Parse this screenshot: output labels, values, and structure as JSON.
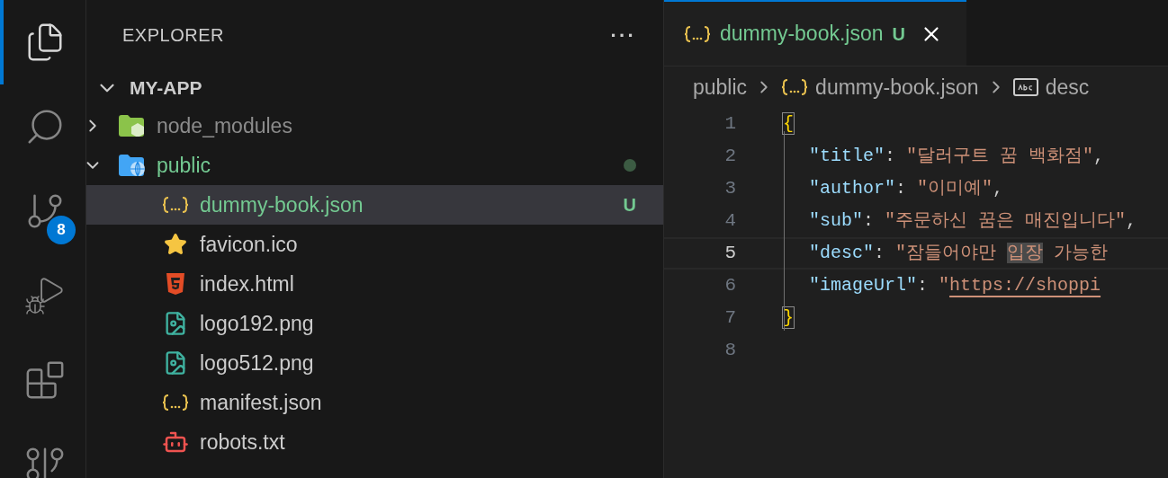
{
  "activity_bar": {
    "items": [
      {
        "kind": "files",
        "selected": true
      },
      {
        "kind": "search",
        "selected": false
      },
      {
        "kind": "source-control",
        "selected": false,
        "badge": "8"
      },
      {
        "kind": "run",
        "selected": false
      },
      {
        "kind": "extensions",
        "selected": false
      },
      {
        "kind": "graph",
        "selected": false
      }
    ]
  },
  "sidebar": {
    "title": "EXPLORER",
    "more": "···",
    "root": {
      "label": "MY-APP",
      "expanded": true,
      "children": [
        {
          "label": "node_modules",
          "kind": "folder-node",
          "expanded": false,
          "untracked": false,
          "ignored": true,
          "selected": false,
          "dot": false
        },
        {
          "label": "public",
          "kind": "folder-web",
          "expanded": true,
          "untracked": true,
          "ignored": false,
          "selected": false,
          "dot": true,
          "children": [
            {
              "label": "dummy-book.json",
              "kind": "json",
              "untracked": true,
              "ignored": false,
              "badge": "U",
              "selected": true
            },
            {
              "label": "favicon.ico",
              "kind": "star",
              "untracked": false,
              "ignored": false,
              "selected": false
            },
            {
              "label": "index.html",
              "kind": "html",
              "untracked": false,
              "ignored": false,
              "selected": false
            },
            {
              "label": "logo192.png",
              "kind": "image",
              "untracked": false,
              "ignored": false,
              "selected": false
            },
            {
              "label": "logo512.png",
              "kind": "image",
              "untracked": false,
              "ignored": false,
              "selected": false
            },
            {
              "label": "manifest.json",
              "kind": "json",
              "untracked": false,
              "ignored": false,
              "selected": false
            },
            {
              "label": "robots.txt",
              "kind": "robot",
              "untracked": false,
              "ignored": false,
              "selected": false
            }
          ]
        }
      ]
    }
  },
  "editor": {
    "tabs": [
      {
        "label": "dummy-book.json",
        "kind": "json",
        "badge": "U",
        "selected": true
      }
    ],
    "breadcrumbs": [
      {
        "label": "public",
        "kind": "folder"
      },
      {
        "label": "dummy-book.json",
        "kind": "json"
      },
      {
        "label": "desc",
        "kind": "string"
      }
    ],
    "lines": [
      {
        "number": "1",
        "selected": false,
        "tokens": [
          {
            "kind": "bracket-match",
            "text": "{"
          }
        ]
      },
      {
        "number": "2",
        "selected": false,
        "tokens": [
          {
            "kind": "key",
            "text": "\"title\""
          },
          {
            "kind": "punct",
            "text": ": "
          },
          {
            "kind": "string",
            "text": "\"달러구트 꿈 백화점\""
          },
          {
            "kind": "punct",
            "text": ","
          }
        ]
      },
      {
        "number": "3",
        "selected": false,
        "tokens": [
          {
            "kind": "key",
            "text": "\"author\""
          },
          {
            "kind": "punct",
            "text": ": "
          },
          {
            "kind": "string",
            "text": "\"이미예\""
          },
          {
            "kind": "punct",
            "text": ","
          }
        ]
      },
      {
        "number": "4",
        "selected": false,
        "tokens": [
          {
            "kind": "key",
            "text": "\"sub\""
          },
          {
            "kind": "punct",
            "text": ": "
          },
          {
            "kind": "string",
            "text": "\"주문하신 꿈은 매진입니다\""
          },
          {
            "kind": "punct",
            "text": ","
          }
        ]
      },
      {
        "number": "5",
        "selected": true,
        "tokens": [
          {
            "kind": "key",
            "text": "\"desc\""
          },
          {
            "kind": "punct",
            "text": ": "
          },
          {
            "kind": "string",
            "text": "\"잠들어야만 "
          },
          {
            "kind": "highlight",
            "text": "입장"
          },
          {
            "kind": "string",
            "text": " 가능한"
          }
        ]
      },
      {
        "number": "6",
        "selected": false,
        "tokens": [
          {
            "kind": "key",
            "text": "\"imageUrl\""
          },
          {
            "kind": "punct",
            "text": ": "
          },
          {
            "kind": "string",
            "text": "\""
          },
          {
            "kind": "link",
            "text": "https://shoppi"
          }
        ]
      },
      {
        "number": "7",
        "selected": false,
        "tokens": [
          {
            "kind": "bracket-match",
            "text": "}"
          }
        ]
      },
      {
        "number": "8",
        "selected": false
      }
    ]
  }
}
